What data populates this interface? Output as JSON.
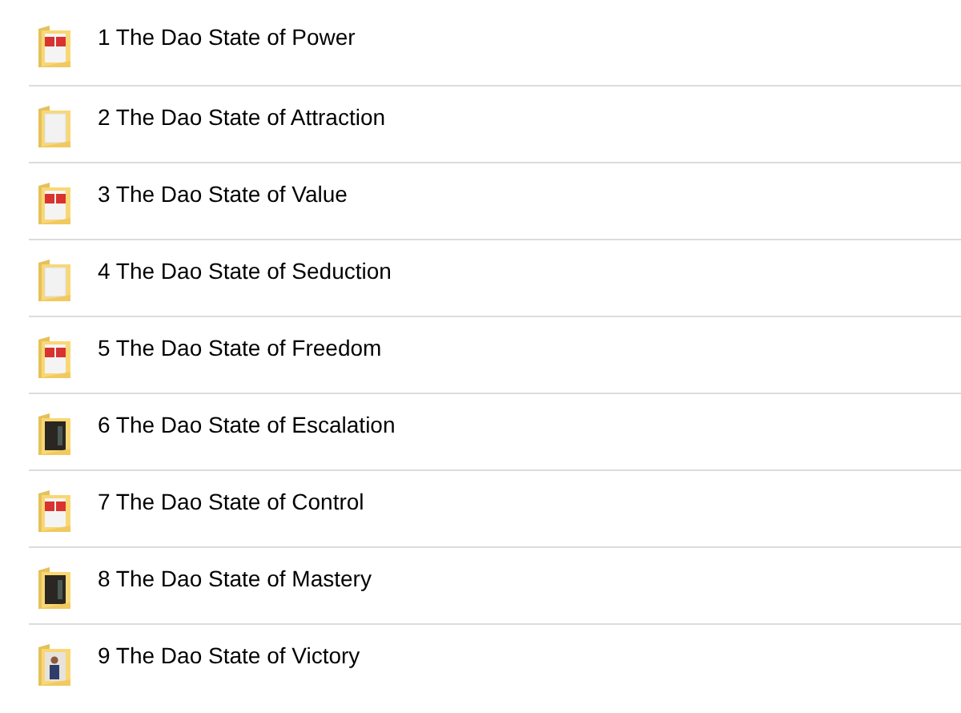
{
  "folders": [
    {
      "name": "1 The Dao State of Power",
      "kind": "red"
    },
    {
      "name": "2 The Dao State of Attraction",
      "kind": "white"
    },
    {
      "name": "3 The Dao State of Value",
      "kind": "red"
    },
    {
      "name": "4 The Dao State of Seduction",
      "kind": "white"
    },
    {
      "name": "5 The Dao State of Freedom",
      "kind": "red"
    },
    {
      "name": "6 The Dao State of Escalation",
      "kind": "dark"
    },
    {
      "name": "7 The Dao State of Control",
      "kind": "red"
    },
    {
      "name": "8 The Dao State of Mastery",
      "kind": "dark"
    },
    {
      "name": "9 The Dao State of Victory",
      "kind": "photo"
    }
  ]
}
